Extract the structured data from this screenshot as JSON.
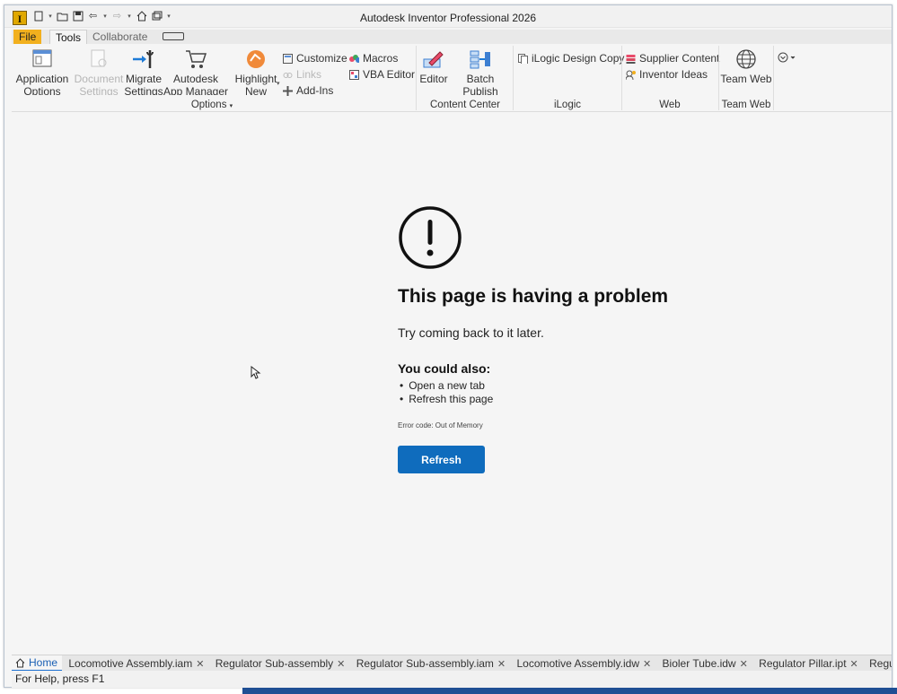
{
  "window": {
    "title": "Autodesk Inventor Professional 2026",
    "logo_letter": "I"
  },
  "quick_access": [
    "new-icon",
    "open-icon",
    "save-icon",
    "undo-icon",
    "redo-icon",
    "home-icon",
    "window-icon",
    "customize-icon"
  ],
  "ribbon_tabs": {
    "file": "File",
    "tools": "Tools",
    "collaborate": "Collaborate"
  },
  "ribbon": {
    "options": {
      "title": "Options",
      "application_options": "Application Options",
      "document_settings": "Document Settings",
      "migrate_settings": "Migrate Settings",
      "app_manager": "Autodesk App Manager",
      "highlight_new": "Highlight New",
      "customize": "Customize",
      "links": "Links",
      "add_ins": "Add-Ins",
      "macros": "Macros",
      "vba_editor": "VBA Editor"
    },
    "content_center": {
      "title": "Content Center",
      "editor": "Editor",
      "batch_publish": "Batch Publish"
    },
    "ilogic": {
      "title": "iLogic",
      "design_copy": "iLogic Design Copy"
    },
    "web": {
      "title": "Web",
      "supplier_content": "Supplier Content",
      "inventor_ideas": "Inventor Ideas"
    },
    "team_web": {
      "title": "Team Web",
      "team_web_button": "Team Web"
    }
  },
  "error_page": {
    "title": "This page is having a problem",
    "subtitle": "Try coming back to it later.",
    "also_heading": "You could also:",
    "suggestions": [
      "Open a new tab",
      "Refresh this page"
    ],
    "error_code": "Error code: Out of Memory",
    "refresh_label": "Refresh"
  },
  "document_tabs": {
    "home": "Home",
    "items": [
      "Locomotive Assembly.iam",
      "Regulator Sub-assembly",
      "Regulator Sub-assembly.iam",
      "Locomotive Assembly.idw",
      "Bioler Tube.idw",
      "Regulator Pillar.ipt",
      "Regulator Handle.ipt"
    ]
  },
  "status": {
    "text": "For Help, press F1"
  },
  "colors": {
    "accent": "#0f6cbd",
    "file_tab": "#f2b01e"
  }
}
